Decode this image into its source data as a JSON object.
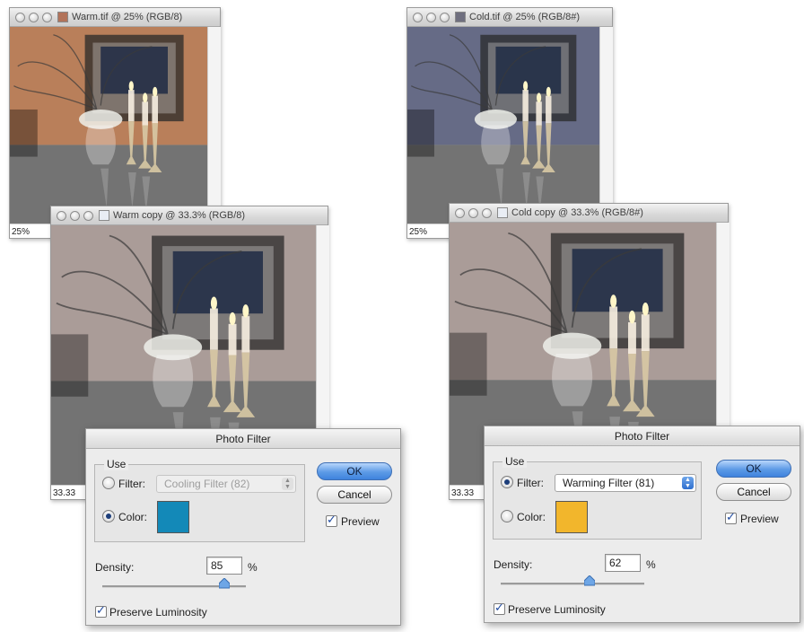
{
  "windows": {
    "warm": {
      "title": "Warm.tif @ 25% (RGB/8)",
      "zoom": "25%"
    },
    "warm_copy": {
      "title": "Warm copy @ 33.3% (RGB/8)",
      "zoom": "33.33"
    },
    "cold": {
      "title": "Cold.tif @ 25% (RGB/8#)",
      "zoom": "25%"
    },
    "cold_copy": {
      "title": "Cold copy @ 33.3% (RGB/8#)",
      "zoom": "33.33"
    }
  },
  "dialogs": {
    "left": {
      "title": "Photo Filter",
      "use_label": "Use",
      "filter_label": "Filter:",
      "filter_value": "Cooling Filter (82)",
      "filter_selected": false,
      "color_label": "Color:",
      "color_selected": true,
      "color": "#1389b8",
      "ok_label": "OK",
      "cancel_label": "Cancel",
      "preview_label": "Preview",
      "preview_checked": true,
      "density_label": "Density:",
      "density_value": "85",
      "density_unit": "%",
      "density_fraction": 0.85,
      "preserve_label": "Preserve Luminosity",
      "preserve_checked": true
    },
    "right": {
      "title": "Photo Filter",
      "use_label": "Use",
      "filter_label": "Filter:",
      "filter_value": "Warming Filter (81)",
      "filter_selected": true,
      "color_label": "Color:",
      "color_selected": false,
      "color": "#f2b62c",
      "ok_label": "OK",
      "cancel_label": "Cancel",
      "preview_label": "Preview",
      "preview_checked": true,
      "density_label": "Density:",
      "density_value": "62",
      "density_unit": "%",
      "density_fraction": 0.62,
      "preserve_label": "Preserve Luminosity",
      "preserve_checked": true
    }
  },
  "colors": {
    "warm_tone": "#c98a62",
    "cold_tone": "#6f7592",
    "neutral_tone": "#b9aaa5"
  }
}
